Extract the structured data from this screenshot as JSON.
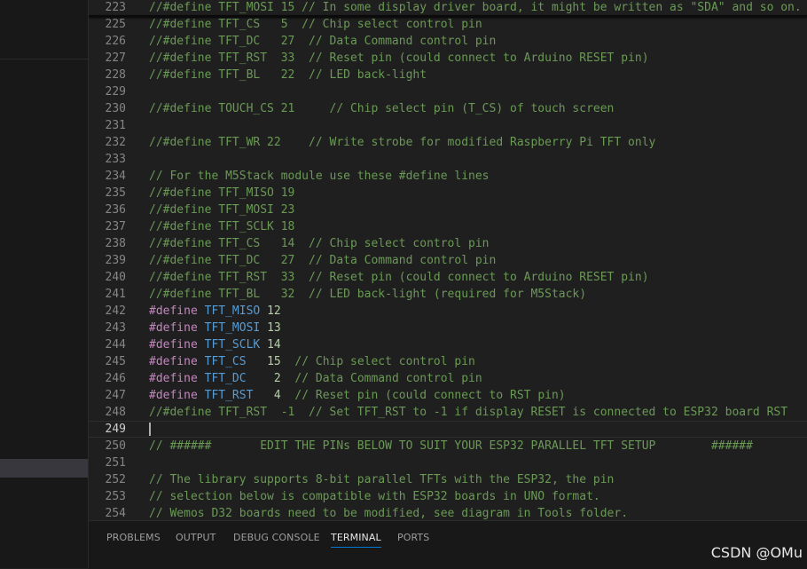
{
  "colors": {
    "comment": "#6a9955",
    "keyword": "#c586c0",
    "macro": "#569cd6",
    "number": "#b5cea8",
    "text": "#d4d4d4",
    "line_number": "#858585",
    "active_tab_underline": "#0078d4"
  },
  "editor": {
    "current_line": "249",
    "lines": [
      {
        "n": "223",
        "tokens": [
          {
            "t": "//#define TFT_MOSI 15 // In some display driver board, it might be written as \"SDA\" and so on.",
            "c": "comment"
          }
        ]
      },
      {
        "n": "225",
        "tokens": [
          {
            "t": "//#define TFT_CS   5  // Chip select control pin",
            "c": "comment"
          }
        ]
      },
      {
        "n": "226",
        "tokens": [
          {
            "t": "//#define TFT_DC   27  // Data Command control pin",
            "c": "comment"
          }
        ]
      },
      {
        "n": "227",
        "tokens": [
          {
            "t": "//#define TFT_RST  33  // Reset pin (could connect to Arduino RESET pin)",
            "c": "comment"
          }
        ]
      },
      {
        "n": "228",
        "tokens": [
          {
            "t": "//#define TFT_BL   22  // LED back-light",
            "c": "comment"
          }
        ]
      },
      {
        "n": "229",
        "tokens": []
      },
      {
        "n": "230",
        "tokens": [
          {
            "t": "//#define TOUCH_CS 21     // Chip select pin (T_CS) of touch screen",
            "c": "comment"
          }
        ]
      },
      {
        "n": "231",
        "tokens": []
      },
      {
        "n": "232",
        "tokens": [
          {
            "t": "//#define TFT_WR 22    // Write strobe for modified Raspberry Pi TFT only",
            "c": "comment"
          }
        ]
      },
      {
        "n": "233",
        "tokens": []
      },
      {
        "n": "234",
        "tokens": [
          {
            "t": "// For the M5Stack module use these #define lines",
            "c": "comment"
          }
        ]
      },
      {
        "n": "235",
        "tokens": [
          {
            "t": "//#define TFT_MISO 19",
            "c": "comment"
          }
        ]
      },
      {
        "n": "236",
        "tokens": [
          {
            "t": "//#define TFT_MOSI 23",
            "c": "comment"
          }
        ]
      },
      {
        "n": "237",
        "tokens": [
          {
            "t": "//#define TFT_SCLK 18",
            "c": "comment"
          }
        ]
      },
      {
        "n": "238",
        "tokens": [
          {
            "t": "//#define TFT_CS   14  // Chip select control pin",
            "c": "comment"
          }
        ]
      },
      {
        "n": "239",
        "tokens": [
          {
            "t": "//#define TFT_DC   27  // Data Command control pin",
            "c": "comment"
          }
        ]
      },
      {
        "n": "240",
        "tokens": [
          {
            "t": "//#define TFT_RST  33  // Reset pin (could connect to Arduino RESET pin)",
            "c": "comment"
          }
        ]
      },
      {
        "n": "241",
        "tokens": [
          {
            "t": "//#define TFT_BL   32  // LED back-light (required for M5Stack)",
            "c": "comment"
          }
        ]
      },
      {
        "n": "242",
        "tokens": [
          {
            "t": "#define",
            "c": "keyword"
          },
          {
            "t": " ",
            "c": "text"
          },
          {
            "t": "TFT_MISO",
            "c": "macro"
          },
          {
            "t": " ",
            "c": "text"
          },
          {
            "t": "12",
            "c": "number"
          }
        ]
      },
      {
        "n": "243",
        "tokens": [
          {
            "t": "#define",
            "c": "keyword"
          },
          {
            "t": " ",
            "c": "text"
          },
          {
            "t": "TFT_MOSI",
            "c": "macro"
          },
          {
            "t": " ",
            "c": "text"
          },
          {
            "t": "13",
            "c": "number"
          }
        ]
      },
      {
        "n": "244",
        "tokens": [
          {
            "t": "#define",
            "c": "keyword"
          },
          {
            "t": " ",
            "c": "text"
          },
          {
            "t": "TFT_SCLK",
            "c": "macro"
          },
          {
            "t": " ",
            "c": "text"
          },
          {
            "t": "14",
            "c": "number"
          }
        ]
      },
      {
        "n": "245",
        "tokens": [
          {
            "t": "#define",
            "c": "keyword"
          },
          {
            "t": " ",
            "c": "text"
          },
          {
            "t": "TFT_CS",
            "c": "macro"
          },
          {
            "t": "   ",
            "c": "text"
          },
          {
            "t": "15",
            "c": "number"
          },
          {
            "t": "  ",
            "c": "text"
          },
          {
            "t": "// Chip select control pin",
            "c": "comment"
          }
        ]
      },
      {
        "n": "246",
        "tokens": [
          {
            "t": "#define",
            "c": "keyword"
          },
          {
            "t": " ",
            "c": "text"
          },
          {
            "t": "TFT_DC",
            "c": "macro"
          },
          {
            "t": "    ",
            "c": "text"
          },
          {
            "t": "2",
            "c": "number"
          },
          {
            "t": "  ",
            "c": "text"
          },
          {
            "t": "// Data Command control pin",
            "c": "comment"
          }
        ]
      },
      {
        "n": "247",
        "tokens": [
          {
            "t": "#define",
            "c": "keyword"
          },
          {
            "t": " ",
            "c": "text"
          },
          {
            "t": "TFT_RST",
            "c": "macro"
          },
          {
            "t": "   ",
            "c": "text"
          },
          {
            "t": "4",
            "c": "number"
          },
          {
            "t": "  ",
            "c": "text"
          },
          {
            "t": "// Reset pin (could connect to RST pin)",
            "c": "comment"
          }
        ]
      },
      {
        "n": "248",
        "tokens": [
          {
            "t": "//#define TFT_RST  -1  // Set TFT_RST to -1 if display RESET is connected to ESP32 board RST",
            "c": "comment"
          }
        ]
      },
      {
        "n": "249",
        "tokens": []
      },
      {
        "n": "250",
        "tokens": [
          {
            "t": "// ######       EDIT THE PINs BELOW TO SUIT YOUR ESP32 PARALLEL TFT SETUP        ######",
            "c": "comment"
          }
        ]
      },
      {
        "n": "251",
        "tokens": []
      },
      {
        "n": "252",
        "tokens": [
          {
            "t": "// The library supports 8-bit parallel TFTs with the ESP32, the pin",
            "c": "comment"
          }
        ]
      },
      {
        "n": "253",
        "tokens": [
          {
            "t": "// selection below is compatible with ESP32 boards in UNO format.",
            "c": "comment"
          }
        ]
      },
      {
        "n": "254",
        "tokens": [
          {
            "t": "// Wemos D32 boards need to be modified, see diagram in Tools folder.",
            "c": "comment"
          }
        ]
      }
    ]
  },
  "panel": {
    "tabs": [
      {
        "label": "PROBLEMS",
        "active": false
      },
      {
        "label": "OUTPUT",
        "active": false
      },
      {
        "label": "DEBUG CONSOLE",
        "active": false
      },
      {
        "label": "TERMINAL",
        "active": true
      },
      {
        "label": "PORTS",
        "active": false
      }
    ]
  },
  "watermark": "CSDN @OMu"
}
